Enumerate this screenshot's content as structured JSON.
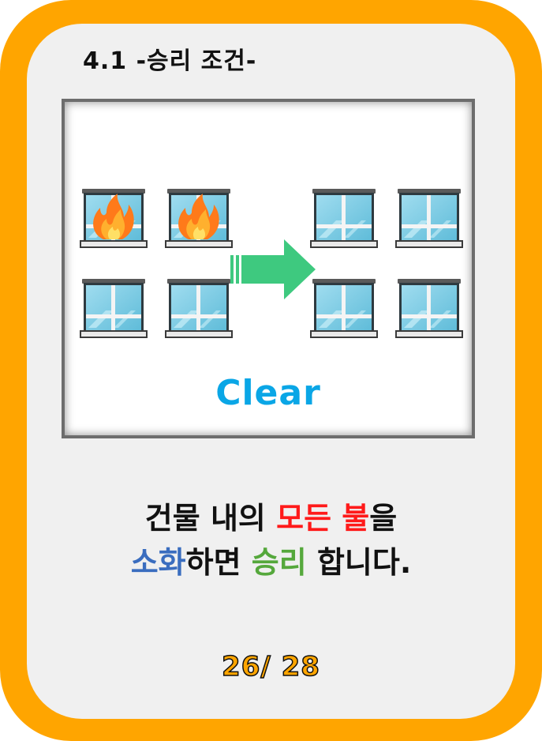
{
  "slide": {
    "title": "4.1 -승리 조건-",
    "panel": {
      "label": "Clear",
      "before_icon": "burning-windows-icon",
      "arrow_icon": "arrow-right-icon",
      "after_icon": "clear-windows-icon"
    },
    "message": {
      "line1": {
        "part1": "건물 내의 ",
        "part2": "모든 불",
        "part3": "을"
      },
      "line2": {
        "part1": "소화",
        "part2": "하면 ",
        "part3": "승리",
        "part4": " 합니다."
      }
    },
    "page": "26/ 28"
  },
  "colors": {
    "frame": "#ffa500",
    "background": "#f0f0f0",
    "clear_text": "#0aa6e6",
    "red_highlight": "#ff1a1a",
    "blue_highlight": "#3a6dbf",
    "green_highlight": "#55a83c",
    "arrow": "#3ec97f"
  }
}
